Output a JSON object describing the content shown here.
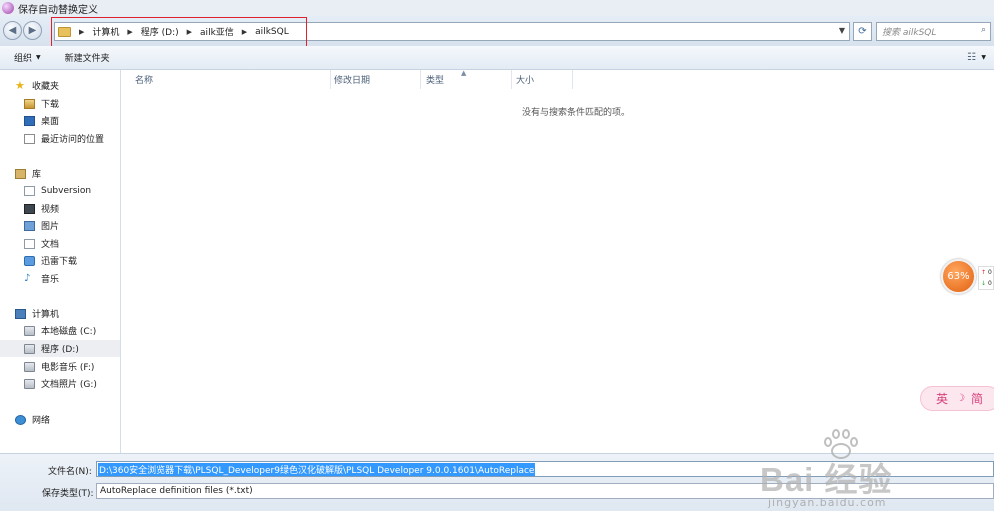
{
  "window": {
    "title": "保存自动替换定义"
  },
  "address": {
    "crumbs": [
      "计算机",
      "程序 (D:)",
      "ailk亚信",
      "ailkSQL"
    ],
    "search_placeholder": "搜索 ailkSQL"
  },
  "toolbar": {
    "organize": "组织",
    "new_folder": "新建文件夹"
  },
  "nav": {
    "favorites": "收藏夹",
    "downloads": "下载",
    "desktop": "桌面",
    "recent": "最近访问的位置",
    "libraries": "库",
    "subversion": "Subversion",
    "videos": "视频",
    "pictures": "图片",
    "documents": "文档",
    "thunder": "迅雷下载",
    "music": "音乐",
    "computer": "计算机",
    "drive_c": "本地磁盘 (C:)",
    "drive_d": "程序 (D:)",
    "drive_f": "电影音乐 (F:)",
    "drive_g": "文档照片 (G:)",
    "network": "网络"
  },
  "columns": {
    "name": "名称",
    "modified": "修改日期",
    "type": "类型",
    "size": "大小"
  },
  "content": {
    "empty_message": "没有与搜索条件匹配的项。"
  },
  "bottom": {
    "filename_label": "文件名(N):",
    "filename_value": "D:\\360安全浏览器下载\\PLSQL_Developer9绿色汉化破解版\\PLSQL Developer 9.0.0.1601\\AutoReplace",
    "filetype_label": "保存类型(T):",
    "filetype_value": "AutoReplace definition files (*.txt)"
  },
  "overlay": {
    "badge_percent": "63%",
    "netspeed_up": "0",
    "netspeed_down": "0",
    "ime_label": "英",
    "ime_mode": "简"
  },
  "watermark": {
    "brand": "Bai  经验",
    "url": "jingyan.baidu.com"
  },
  "colors": {
    "highlight_box": "#e0212c",
    "selection": "#3399ff",
    "badge": "#e2600e"
  }
}
